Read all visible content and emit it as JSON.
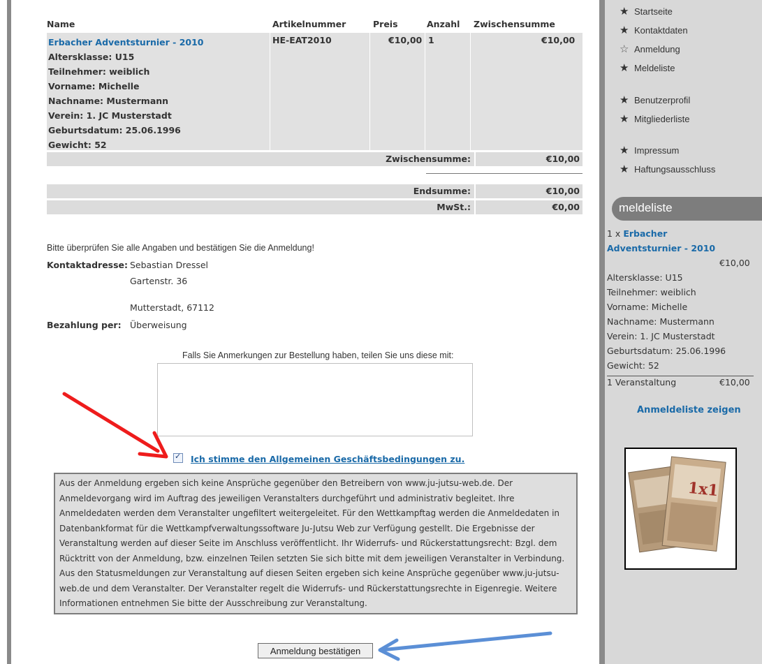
{
  "cart": {
    "headers": {
      "name": "Name",
      "sku": "Artikelnummer",
      "price": "Preis",
      "qty": "Anzahl",
      "subtotal": "Zwischensumme"
    },
    "item": {
      "title": "Erbacher Adventsturnier - 2010",
      "sku": "HE-EAT2010",
      "price": "€10,00",
      "qty": "1",
      "subtotal": "€10,00",
      "details": [
        "Altersklasse: U15",
        "Teilnehmer: weiblich",
        "Vorname: Michelle",
        "Nachname: Mustermann",
        "Verein: 1. JC Musterstadt",
        "Geburtsdatum: 25.06.1996",
        "Gewicht: 52"
      ]
    },
    "subtotal_label": "Zwischensumme:",
    "subtotal_value": "€10,00",
    "total_label": "Endsumme:",
    "total_value": "€10,00",
    "vat_label": "MwSt.:",
    "vat_value": "€0,00"
  },
  "confirm": {
    "instruction": "Bitte überprüfen Sie alle Angaben und bestätigen Sie die Anmeldung!",
    "contact_label": "Kontaktadresse:",
    "contact_lines": [
      "Sebastian Dressel",
      "Gartenstr. 36",
      "",
      "Mutterstadt, 67112"
    ],
    "payment_label": "Bezahlung per:",
    "payment_value": "Überweisung",
    "remark_label": "Falls Sie Anmerkungen zur Bestellung haben, teilen Sie uns diese mit:",
    "remark_value": "",
    "agb_checked": true,
    "agb_label": "Ich stimme den Allgemeinen Geschäftsbedingungen zu.",
    "terms_text": "Aus der Anmeldung ergeben sich keine Ansprüche gegenüber den Betreibern von www.ju-jutsu-web.de. Der Anmeldevorgang wird im Auftrag des jeweiligen Veranstalters durchgeführt und administrativ begleitet. Ihre Anmeldedaten werden dem Veranstalter ungefiltert weitergeleitet. Für den Wettkampftag werden die Anmeldedaten in Datenbankformat für die Wettkampfverwaltungssoftware Ju-Jutsu Web zur Verfügung gestellt. Die Ergebnisse der Veranstaltung werden auf dieser Seite im Anschluss veröffentlicht. Ihr Widerrufs- und Rückerstattungsrecht: Bzgl. dem Rücktritt von der Anmeldung, bzw. einzelnen Teilen setzten Sie sich bitte mit dem jeweiligen Veranstalter in Verbindung. Aus den Statusmeldungen zur Veranstaltung auf diesen Seiten ergeben sich keine Ansprüche gegenüber www.ju-jutsu-web.de und dem Veranstalter. Der Veranstalter regelt die Widerrufs- und Rückerstattungsrechte in Eigenregie. Weitere Informationen entnehmen Sie bitte der Ausschreibung zur Veranstaltung.",
    "submit_label": "Anmeldung bestätigen"
  },
  "sidebar": {
    "nav": [
      "Startseite",
      "Kontaktdaten",
      "Anmeldung",
      "Meldeliste",
      "Benutzerprofil",
      "Mitgliederliste",
      "Impressum",
      "Haftungsausschluss"
    ],
    "box_title": "meldeliste",
    "item_prefix": "1 x ",
    "item_title_1": "Erbacher",
    "item_title_2": "Adventsturnier - 2010",
    "item_price": "€10,00",
    "item_details": [
      "Altersklasse: U15",
      "Teilnehmer: weiblich",
      "Vorname: Michelle",
      "Nachname: Mustermann",
      "Verein: 1. JC Musterstadt",
      "Geburtsdatum: 25.06.1996",
      "Gewicht: 52"
    ],
    "summary_label": "1 Veranstaltung",
    "summary_value": "€10,00",
    "show_list": "Anmeldeliste zeigen"
  },
  "colors": {
    "link": "#1a6aa8",
    "red_arrow": "#ee1c1c",
    "blue_arrow": "#5b8fd6"
  }
}
